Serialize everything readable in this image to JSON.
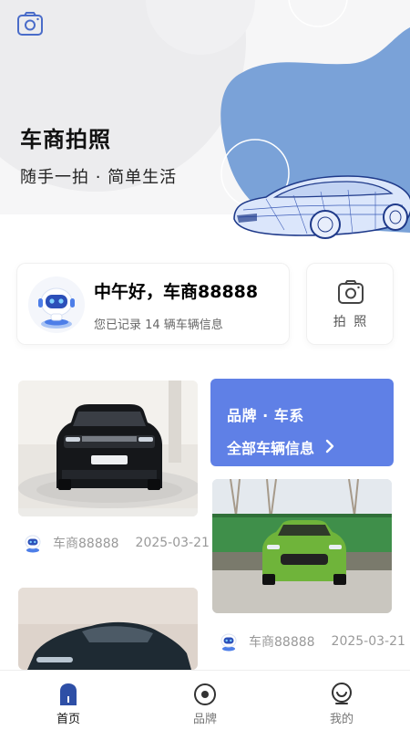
{
  "hero": {
    "title": "车商拍照",
    "subtitle": "随手一拍 · 简单生活"
  },
  "greeting": {
    "title": "中午好，车商88888",
    "subtitle": "您已记录 14 辆车辆信息"
  },
  "photo_button": {
    "label": "拍 照"
  },
  "brand_card": {
    "title": "品牌 · 车系",
    "link": "全部车辆信息"
  },
  "feed": [
    {
      "user": "车商88888",
      "date": "2025-03-21",
      "image": "black-suv-photo"
    },
    {
      "user": "车商88888",
      "date": "2025-03-21",
      "image": "green-suv-photo"
    },
    {
      "user": "",
      "date": "",
      "image": "dark-sedan-photo"
    }
  ],
  "tabs": [
    {
      "label": "首页",
      "icon": "home-icon",
      "active": true
    },
    {
      "label": "品牌",
      "icon": "brand-icon",
      "active": false
    },
    {
      "label": "我的",
      "icon": "profile-icon",
      "active": false
    }
  ],
  "colors": {
    "accent_blue": "#5f80e6",
    "hero_blob_blue": "#7aa2d8",
    "active_tab_icon": "#2e4fa6"
  }
}
